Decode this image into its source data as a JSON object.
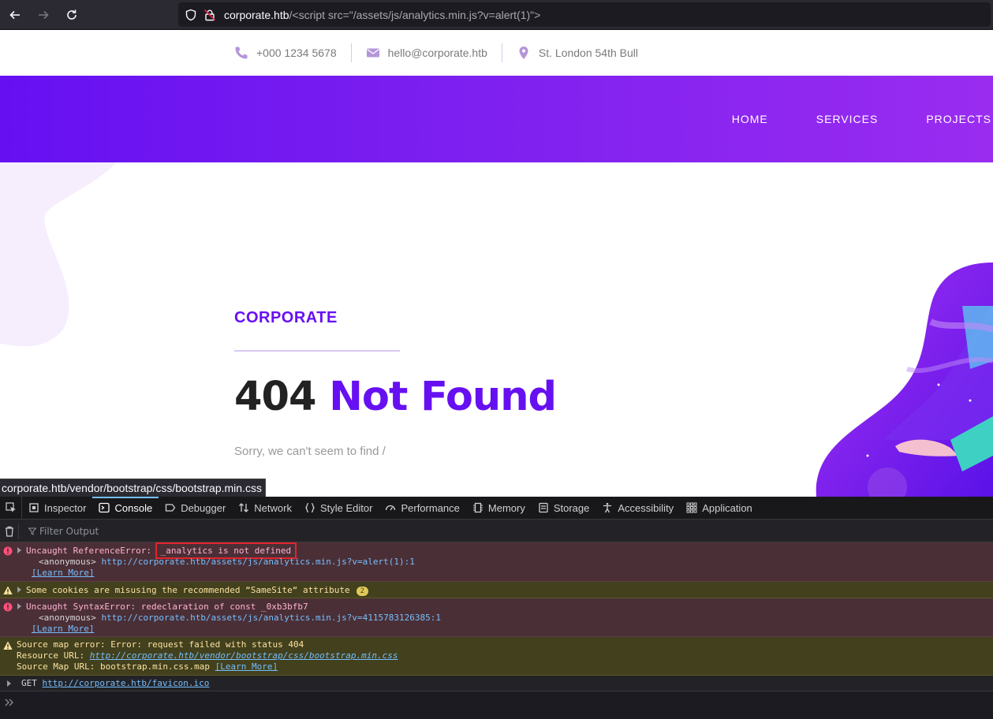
{
  "browser": {
    "url_host": "corporate.htb",
    "url_rest": "/<script src=\"/assets/js/analytics.min.js?v=alert(1)\">"
  },
  "page": {
    "contacts": {
      "phone": "+000 1234 5678",
      "email": "hello@corporate.htb",
      "address": "St. London 54th Bull"
    },
    "nav": [
      "HOME",
      "SERVICES",
      "PROJECTS"
    ],
    "brand": "CORPORATE",
    "heading_number": "404",
    "heading_text": "Not Found",
    "sorry": "Sorry, we can't seem to find /",
    "accent_color": "#6610f2"
  },
  "status_link": "corporate.htb/vendor/bootstrap/css/bootstrap.min.css",
  "devtools": {
    "tabs": [
      "Inspector",
      "Console",
      "Debugger",
      "Network",
      "Style Editor",
      "Performance",
      "Memory",
      "Storage",
      "Accessibility",
      "Application"
    ],
    "selected_tab": "Console",
    "filter_placeholder": "Filter Output",
    "messages": {
      "m1": {
        "prefix": "Uncaught ReferenceError: ",
        "highlight": "_analytics is not defined",
        "anon": "<anonymous>",
        "url": "http://corporate.htb/assets/js/analytics.min.js?v=alert(1):1",
        "learn": "[Learn More]"
      },
      "m2": {
        "text": "Some cookies are misusing the recommended “SameSite“ attribute",
        "count": "2"
      },
      "m3": {
        "text": "Uncaught SyntaxError: redeclaration of const _0xb3bfb7",
        "anon": "<anonymous>",
        "url": "http://corporate.htb/assets/js/analytics.min.js?v=4115783126385:1",
        "learn": "[Learn More]"
      },
      "m4": {
        "line1": "Source map error: Error: request failed with status 404",
        "res_label": "Resource URL: ",
        "res_url": "http://corporate.htb/vendor/bootstrap/css/bootstrap.min.css",
        "map_label": "Source Map URL: bootstrap.min.css.map ",
        "learn": "[Learn More]"
      },
      "m5": {
        "method": "GET ",
        "url": "http://corporate.htb/favicon.ico"
      }
    }
  }
}
